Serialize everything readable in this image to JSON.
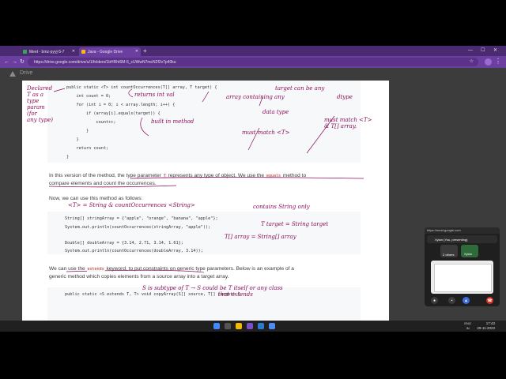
{
  "browser": {
    "tabs": [
      {
        "label": "Meet - bmz-pyyj-5-7",
        "active": false
      },
      {
        "label": "Java - Google Drive",
        "active": true
      }
    ],
    "new_tab": "+",
    "url": "https://drive.google.com/drive/u/1/folders/1bHRhI6M-5_cUWwN7mcN2f2v7p40ku",
    "win_min": "—",
    "win_max": "☐",
    "win_close": "✕"
  },
  "drive": {
    "title": "Drive"
  },
  "document": {
    "code1": [
      "public static <T> int countOccurrences(T[] array, T target) {",
      "    int count = 0;",
      "    for (int i = 0; i < array.length; i++) {",
      "        if (array[i].equals(target)) {",
      "            count++;",
      "        }",
      "    }",
      "    return count;",
      "}"
    ],
    "para1": {
      "a": "In this version of the method, the type parameter ",
      "code": "T",
      "b": " represents any type of object. We use the ",
      "code2": "equals",
      "c": " method to",
      "line2": "compare elements and count the occurrences."
    },
    "para2": "Now, we can use this method as follows:",
    "code2": [
      "String[] stringArray = {\"apple\", \"orange\", \"banana\", \"apple\"};",
      "System.out.println(countOccurrences(stringArray, \"apple\"));",
      "",
      "Double[] doubleArray = {3.14, 2.71, 3.14, 1.61};",
      "System.out.println(countOccurrences(doubleArray, 3.14));"
    ],
    "para3": {
      "a": "We can use the ",
      "code": "extends",
      "b": " keyword, to put constraints on generic type parameters. Below is an example of a",
      "line2": "generic method which copies elements from a source array into a target array."
    },
    "code3": [
      "public static <S extends T, T> void copyArray(S[] source, T[] target) {"
    ]
  },
  "annotations": {
    "left_note": "Declared\nT as a\ntype\nparam\n(for\nany type)",
    "returns": "returns int val",
    "target_any": "target can be any",
    "dtype": "dtype",
    "array_any": "array containing any",
    "data_type": "data type",
    "builtin": "built in method",
    "must_match_t": "must match <T>",
    "must_match_arr": "must match <T>\n& T[] array.",
    "string_t": "<T> = String & countOccurrences <String>",
    "contains_string": "contains String only",
    "t_target": "T target = String target",
    "t_array": "T[] array = String[] array",
    "s_subtype": "S is subtype of T → S could be T itself or any class\n                                           that extends"
  },
  "meet": {
    "top_label": "https://meet.google.com",
    "presenter": "Xyian (You, presenting)",
    "others": "2 others",
    "tile_label": "Xyian"
  },
  "taskbar": {
    "lang_top": "ENG",
    "lang_bottom": "IN",
    "time": "17:43",
    "date": "29-11-2023"
  },
  "colors": {
    "browser_frame": "#6b3fa0",
    "annotation_ink": "#8b0e5a",
    "page_bg": "#ffffff",
    "taskbar_bg": "#202020"
  }
}
